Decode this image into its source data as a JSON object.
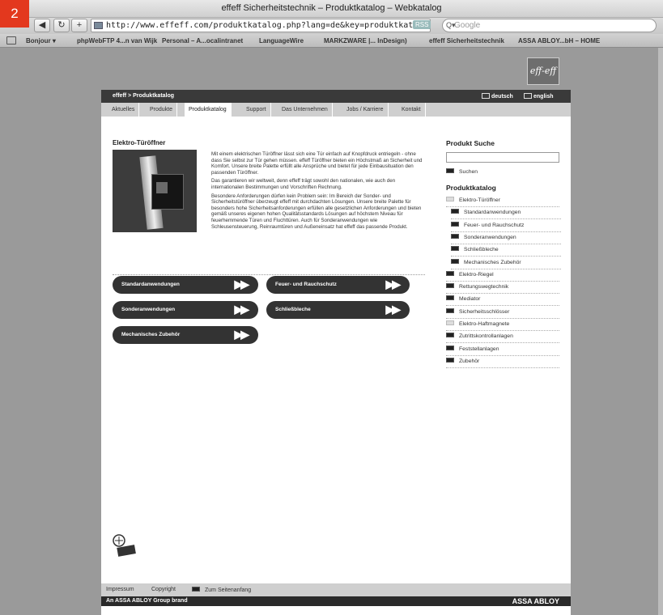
{
  "browser": {
    "corner_badge": "2",
    "title": "effeff Sicherheitstechnik – Produktkatalog – Webkatalog",
    "url": "http://www.effeff.com/produktkatalog.php?lang=de&key=produktkatalog",
    "rss": "RSS",
    "search_placeholder": "Google",
    "bookmarks": [
      "Bonjour ▾",
      "phpWebFTP 4...n van Wijk",
      "Personal – A...ocalintranet",
      "LanguageWire",
      "MARKZWARE |... InDesign)",
      "effeff Sicherheitstechnik",
      "ASSA ABLOY...bH – HOME"
    ]
  },
  "header": {
    "logo": "eff-eff",
    "breadcrumb": "effeff > Produktkatalog",
    "lang_de": "deutsch",
    "lang_en": "english"
  },
  "tabs": [
    "Aktuelles",
    "Produkte",
    "Produktkatalog",
    "Support",
    "Das Unternehmen",
    "Jobs / Karriere",
    "Kontakt"
  ],
  "main": {
    "title": "Elektro-Türöffner",
    "para1": "Mit einem elektrischen Türöffner lässt sich eine Tür einfach auf Knopfdruck entriegeln - ohne dass Sie selbst zur Tür gehen müssen. effeff Türöffner bieten ein Höchstmaß an Sicherheit und Komfort. Unsere breite Palette erfüllt alle Ansprüche und bietet für jede Einbausituation den passenden Türöffner.",
    "para2": "Das garantieren wir weltweit, denn effeff trägt sowohl den nationalen, wie auch den internationalen Bestimmungen und Vorschriften Rechnung.",
    "para3": "Besondere Anforderungen dürfen kein Problem sein: Im Bereich der Sonder- und Sicherheitstüröffner überzeugt effeff mit durchdachten Lösungen. Unsere breite Palette für besonders hohe Sicherheitsanforderungen erfüllen alle gesetzlichen Anforderungen und bieten gemäß unseres eigenen hohen Qualitätsstandards Lösungen auf höchstem Niveau für feuerhemmende Türen und Fluchttüren. Auch für Sonderanwendungen wie Schleusensteuerung, Reinraumtüren und Außeneinsatz hat effeff das passende Produkt.",
    "buttons": [
      "Standardanwendungen",
      "Feuer- und Rauchschutz",
      "Sonderanwendungen",
      "Schließbleche",
      "Mechanisches Zubehör"
    ]
  },
  "sidebar": {
    "search_title": "Produkt Suche",
    "search_button": "Suchen",
    "catalog_title": "Produktkatalog",
    "items": [
      {
        "label": "Elektro-Türöffner",
        "sub": false,
        "light": true
      },
      {
        "label": "Standardanwendungen",
        "sub": true,
        "light": false
      },
      {
        "label": "Feuer- und Rauchschutz",
        "sub": true,
        "light": false
      },
      {
        "label": "Sonderanwendungen",
        "sub": true,
        "light": false
      },
      {
        "label": "Schließbleche",
        "sub": true,
        "light": false
      },
      {
        "label": "Mechanisches Zubehör",
        "sub": true,
        "light": false
      },
      {
        "label": "Elektro-Riegel",
        "sub": false,
        "light": false
      },
      {
        "label": "Rettungswegtechnik",
        "sub": false,
        "light": false
      },
      {
        "label": "Mediator",
        "sub": false,
        "light": false
      },
      {
        "label": "Sicherheitsschlösser",
        "sub": false,
        "light": false
      },
      {
        "label": "Elektro-Haftmagnete",
        "sub": false,
        "light": true
      },
      {
        "label": "Zutrittskontrollanlagen",
        "sub": false,
        "light": false
      },
      {
        "label": "Feststellanlagen",
        "sub": false,
        "light": false
      },
      {
        "label": "Zubehör",
        "sub": false,
        "light": false
      }
    ]
  },
  "footer": {
    "impressum": "Impressum",
    "copyright": "Copyright",
    "top": "Zum Seitenanfang",
    "brand_left": "An ASSA ABLOY Group brand",
    "brand_right": "ASSA ABLOY"
  }
}
